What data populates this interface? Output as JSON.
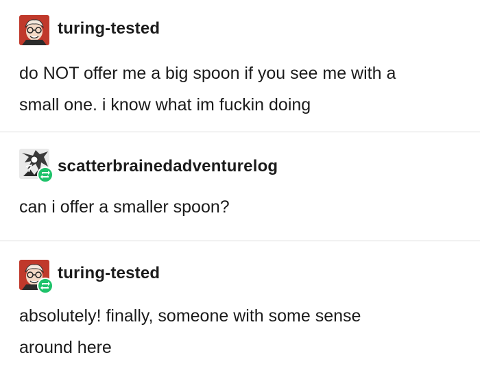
{
  "posts": [
    {
      "username": "turing-tested",
      "avatar_icon": "cartoon-face-avatar-icon",
      "reblogged": false,
      "lines": [
        "do NOT offer me a big spoon if you see me with a",
        "small one. i know what im fuckin doing"
      ]
    },
    {
      "username": "scatterbrainedadventurelog",
      "avatar_icon": "sketch-avatar-icon",
      "reblogged": true,
      "lines": [
        "can i offer a smaller spoon?"
      ]
    },
    {
      "username": "turing-tested",
      "avatar_icon": "cartoon-face-avatar-icon",
      "reblogged": true,
      "lines": [
        "absolutely! finally, someone with some sense",
        "around here"
      ]
    }
  ],
  "colors": {
    "text": "#1b1b1b",
    "reblog_badge": "#1ec26a",
    "avatar_red": "#c0392b",
    "divider": "#dcdcdc"
  }
}
